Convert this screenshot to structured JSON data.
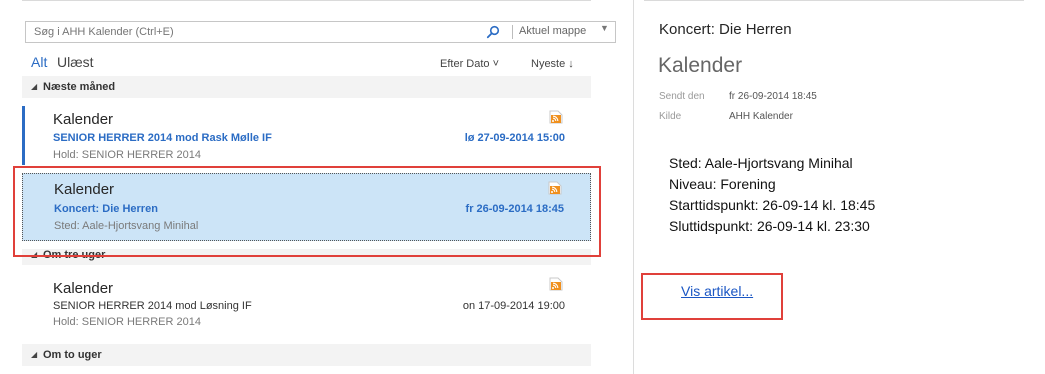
{
  "search": {
    "placeholder": "Søg i AHH Kalender (Ctrl+E)",
    "scope_label": "Aktuel mappe",
    "icon": "search-icon"
  },
  "filters": {
    "all": "Alt",
    "unread": "Ulæst"
  },
  "sort": {
    "by": "Efter Dato ˅",
    "order": "Nyeste ↓"
  },
  "groups": [
    {
      "label": "Næste måned"
    },
    {
      "label": "Om tre uger"
    },
    {
      "label": "Om to uger"
    }
  ],
  "items": [
    {
      "sender": "Kalender",
      "subject": "SENIOR HERRER 2014 mod Rask Mølle IF",
      "date": "lø 27-09-2014 15:00",
      "preview": "Hold: SENIOR HERRER 2014",
      "unread": true,
      "icon": "rss-feed-icon"
    },
    {
      "sender": "Kalender",
      "subject": "Koncert: Die Herren",
      "date": "fr 26-09-2014 18:45",
      "preview": "Sted: Aale-Hjortsvang Minihal",
      "unread": true,
      "selected": true,
      "icon": "rss-feed-icon"
    },
    {
      "sender": "Kalender",
      "subject": "SENIOR HERRER 2014 mod Løsning IF",
      "date": "on 17-09-2014 19:00",
      "preview": "Hold: SENIOR HERRER 2014",
      "unread": false,
      "icon": "rss-feed-icon"
    }
  ],
  "reading": {
    "subject": "Koncert: Die Herren",
    "folder": "Kalender",
    "sent_label": "Sendt den",
    "sent_value": "fr 26-09-2014 18:45",
    "source_label": "Kilde",
    "source_value": "AHH Kalender",
    "body": [
      "Sted: Aale-Hjortsvang Minihal",
      "Niveau: Forening",
      "Starttidspunkt: 26-09-14 kl. 18:45",
      "Sluttidspunkt: 26-09-14 kl. 23:30"
    ],
    "link": "Vis artikel..."
  },
  "colors": {
    "accent": "#2b6cc4",
    "selected_bg": "#cce4f7",
    "annotation": "#e0403a",
    "rss": "#f0901e"
  }
}
